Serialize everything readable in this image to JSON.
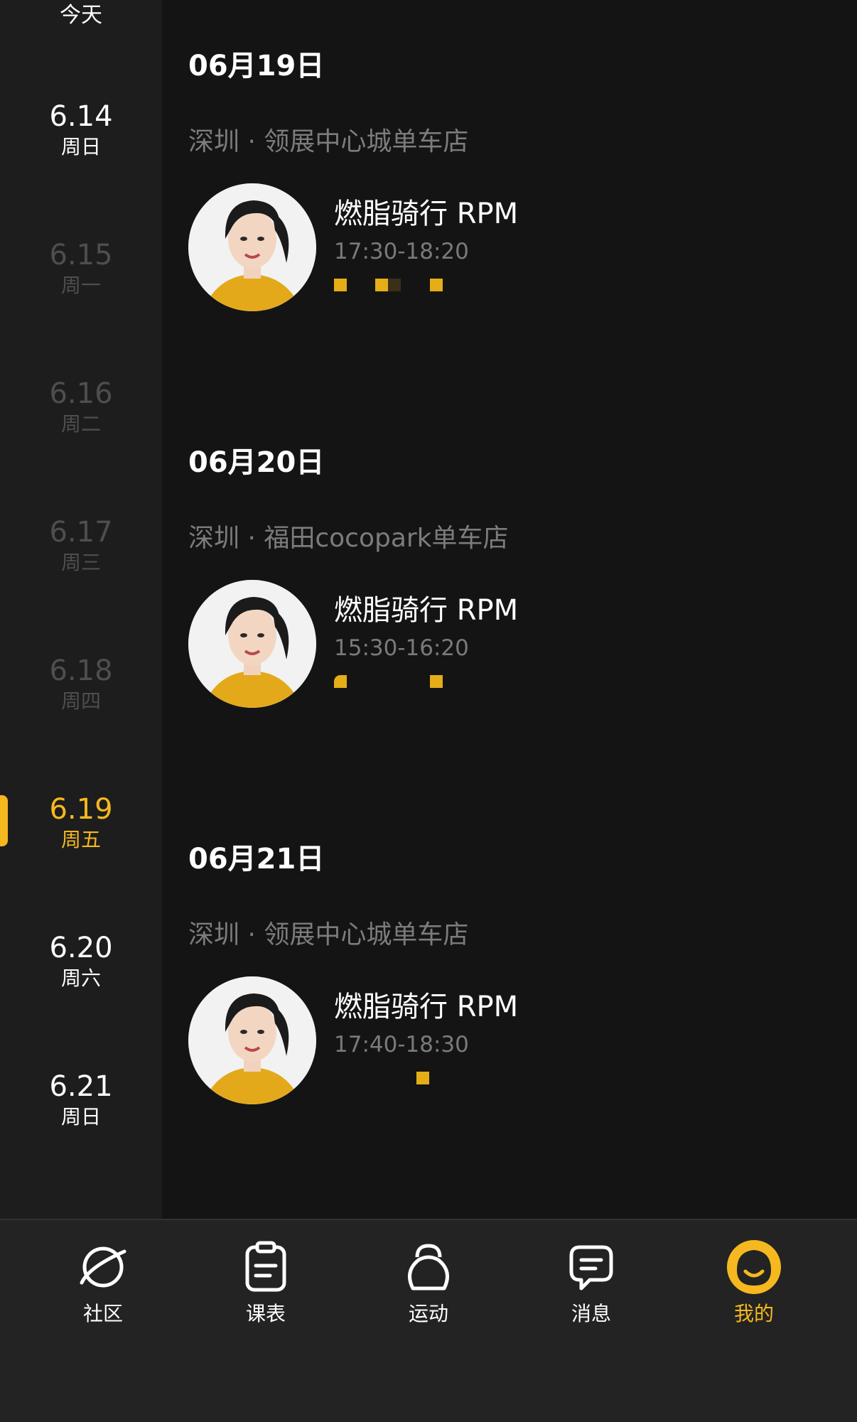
{
  "sidebar": {
    "today_label": "今天",
    "dates": [
      {
        "date": "6.14",
        "weekday": "周日"
      },
      {
        "date": "6.15",
        "weekday": "周一"
      },
      {
        "date": "6.16",
        "weekday": "周二"
      },
      {
        "date": "6.17",
        "weekday": "周三"
      },
      {
        "date": "6.18",
        "weekday": "周四"
      },
      {
        "date": "6.19",
        "weekday": "周五"
      },
      {
        "date": "6.20",
        "weekday": "周六"
      },
      {
        "date": "6.21",
        "weekday": "周日"
      }
    ],
    "selected": "6.19"
  },
  "schedule": [
    {
      "day": "06月19日",
      "store": "深圳 · 领展中心城单车店",
      "class_name": "燃脂骑行 RPM",
      "time": "17:30-18:20"
    },
    {
      "day": "06月20日",
      "store": "深圳 · 福田cocopark单车店",
      "class_name": "燃脂骑行 RPM",
      "time": "15:30-16:20"
    },
    {
      "day": "06月21日",
      "store": "深圳 · 领展中心城单车店",
      "class_name": "燃脂骑行 RPM",
      "time": "17:40-18:30"
    }
  ],
  "tabbar": {
    "items": [
      {
        "label": "社区",
        "icon": "planet-icon"
      },
      {
        "label": "课表",
        "icon": "clipboard-icon"
      },
      {
        "label": "运动",
        "icon": "kettlebell-icon"
      },
      {
        "label": "消息",
        "icon": "chat-icon"
      },
      {
        "label": "我的",
        "icon": "profile-face-icon"
      }
    ],
    "active_index": 4
  },
  "colors": {
    "accent": "#f5b81f",
    "background": "#141414",
    "sidebar": "#1d1d1d",
    "tabbar": "#232323"
  }
}
